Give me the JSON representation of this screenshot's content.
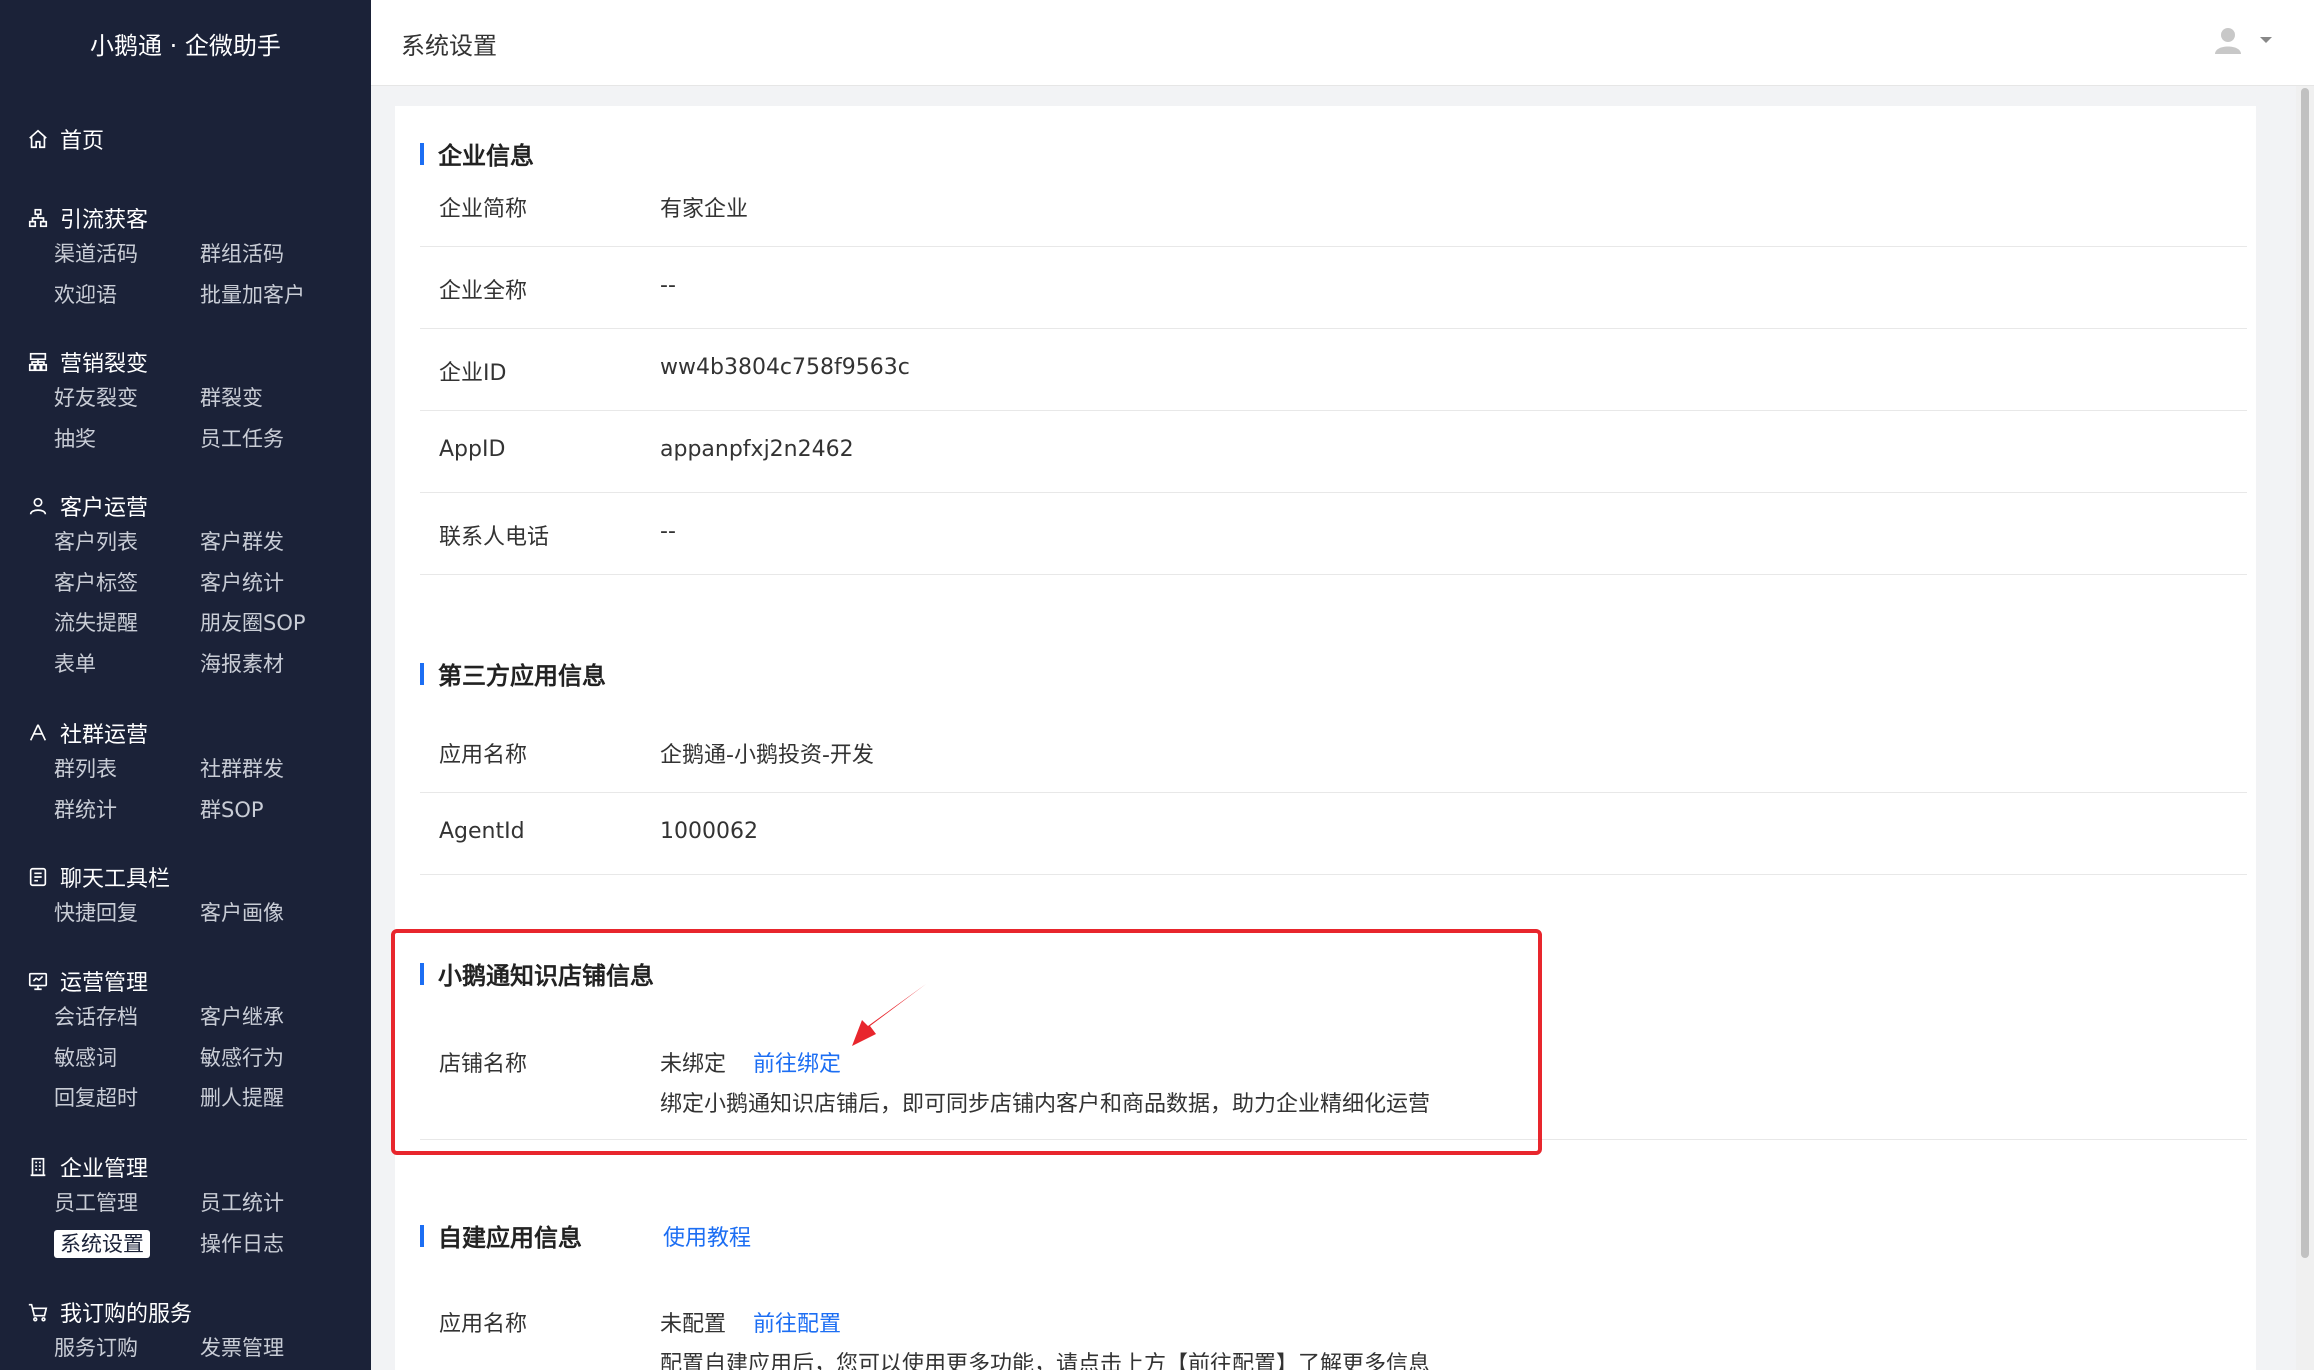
{
  "app": {
    "brand": "小鹅通 · 企微助手",
    "page_title": "系统设置"
  },
  "sidebar": {
    "home": "首页",
    "groups": [
      {
        "title": "引流获客",
        "icon": "org-chart-icon",
        "items": [
          "渠道活码",
          "群组活码",
          "欢迎语",
          "批量加客户"
        ]
      },
      {
        "title": "营销裂变",
        "icon": "sitemap-icon",
        "items": [
          "好友裂变",
          "群裂变",
          "抽奖",
          "员工任务"
        ]
      },
      {
        "title": "客户运营",
        "icon": "user-icon",
        "items": [
          "客户列表",
          "客户群发",
          "客户标签",
          "客户统计",
          "流失提醒",
          "朋友圈SOP",
          "表单",
          "海报素材"
        ]
      },
      {
        "title": "社群运营",
        "icon": "group-icon",
        "items": [
          "群列表",
          "社群群发",
          "群统计",
          "群SOP"
        ]
      },
      {
        "title": "聊天工具栏",
        "icon": "toolbar-icon",
        "items": [
          "快捷回复",
          "客户画像"
        ]
      },
      {
        "title": "运营管理",
        "icon": "monitor-icon",
        "items": [
          "会话存档",
          "客户继承",
          "敏感词",
          "敏感行为",
          "回复超时",
          "删人提醒"
        ]
      },
      {
        "title": "企业管理",
        "icon": "building-icon",
        "items": [
          "员工管理",
          "员工统计",
          "系统设置",
          "操作日志"
        ]
      },
      {
        "title": "我订购的服务",
        "icon": "cart-icon",
        "items": [
          "服务订购",
          "发票管理"
        ]
      }
    ],
    "active_item": "系统设置"
  },
  "sections": {
    "enterprise": {
      "title": "企业信息",
      "rows": [
        {
          "label": "企业简称",
          "value": "有家企业"
        },
        {
          "label": "企业全称",
          "value": "--"
        },
        {
          "label": "企业ID",
          "value": "ww4b3804c758f9563c"
        },
        {
          "label": "AppID",
          "value": "appanpfxj2n2462"
        },
        {
          "label": "联系人电话",
          "value": "--"
        }
      ]
    },
    "third_party": {
      "title": "第三方应用信息",
      "rows": [
        {
          "label": "应用名称",
          "value": "企鹅通-小鹅投资-开发"
        },
        {
          "label": "AgentId",
          "value": "1000062"
        }
      ]
    },
    "shop": {
      "title": "小鹅通知识店铺信息",
      "label": "店铺名称",
      "status": "未绑定",
      "action": "前往绑定",
      "hint": "绑定小鹅通知识店铺后，即可同步店铺内客户和商品数据，助力企业精细化运营"
    },
    "custom_app": {
      "title": "自建应用信息",
      "tutorial": "使用教程",
      "label": "应用名称",
      "status": "未配置",
      "action": "前往配置",
      "hint": "配置自建应用后，您可以使用更多功能，请点击上方【前往配置】了解更多信息"
    }
  },
  "colors": {
    "sidebar_bg": "#1b2238",
    "accent": "#1c6ef3",
    "highlight": "#e8262d"
  }
}
